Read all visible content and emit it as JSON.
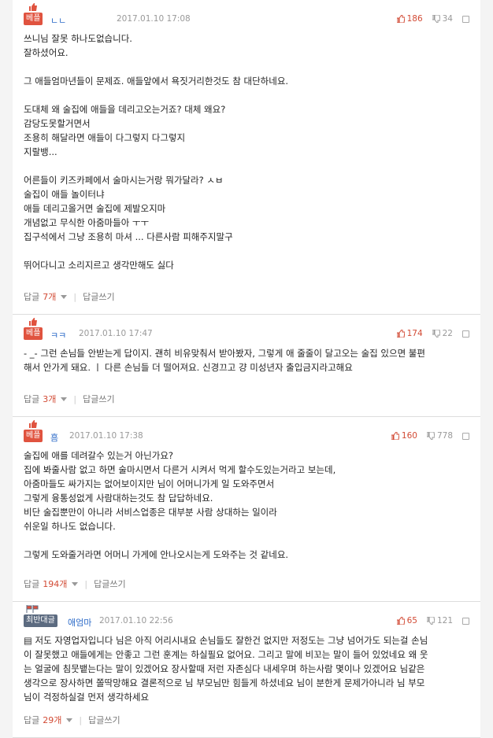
{
  "comments": [
    {
      "badge": "베플",
      "user": "ㄴㄴ",
      "date": "2017.01.10 17:08",
      "up": "186",
      "down": "34",
      "body": "쓰니님 잘못 하나도없습니다.\n잘하셨어요.\n\n그 애들엄마년들이 문제죠. 애들앞에서 욕짓거리한것도 참 대단하네요.\n\n도대체 왜 술집에 애들을 데리고오는거죠? 대체 왜요?\n감당도못할거면서\n조용히 해달라면 애들이 다그렇지 다그렇지\n지랄뱅...\n\n어른들이 키즈카페에서 술마시는거랑 뭐가달라? ㅅㅂ\n술집이 애들 놀이터냐\n애들 데리고올거면 술집에 제발오지마\n개념없고 무식한 아줌마들아 ㅜㅜ\n집구석에서 그냥 조용히 마셔 ... 다른사람 피해주지말구\n\n뛰어다니고 소리지르고 생각만해도 싫다",
      "reply_label": "답글",
      "reply_count": "7개",
      "write_label": "답글쓰기"
    },
    {
      "badge": "베플",
      "user": "ㅋㅋ",
      "date": "2017.01.10 17:47",
      "up": "174",
      "down": "22",
      "body": "- _- 그런 손님들 안받는게 답이지. 괜히 비유맞춰서 받아봤자, 그렇게 애 줄줄이 달고오는 술집 있으면 불편\n해서 안가게 돼요. ㅣ 다른 손님들 더 떨어져요. 신경끄고 걍 미성년자 출입금지라고해요",
      "reply_label": "답글",
      "reply_count": "3개",
      "write_label": "답글쓰기"
    },
    {
      "badge": "베플",
      "user": "흠",
      "date": "2017.01.10 17:38",
      "up": "160",
      "down": "778",
      "body": "술집에 애를 데려갈수 있는거 아닌가요?\n집에 봐줄사람 없고 하면 술마시면서 다른거 시켜서 먹게 할수도있는거라고 보는데,\n아줌마들도 싸가지는 없어보이지만 님이 어머니가게 일 도와주면서\n그렇게 융통성없게 사람대하는것도 참 답답하네요.\n비단 술집뿐만이 아니라 서비스업종은 대부분 사람 상대하는 일이라\n쉬운일 하나도 없습니다.\n\n그렇게 도와줄거라면 어머니 가게에 안나오시는게 도와주는 것 같네요.",
      "reply_label": "답글",
      "reply_count": "194개",
      "write_label": "답글쓰기"
    },
    {
      "badge": "최반대글",
      "user": "애엄마",
      "date": "2017.01.10 22:56",
      "up": "65",
      "down": "121",
      "body": "▤ 저도 자영업자입니다 님은 아직 어리시내요 손님들도 잘한건 없지만 저정도는 그냥 넘어가도 되는걸 손님\n이 잘못했고 애들에게는 안좋고 그런 훈계는 하실필요 없어요. 그리고 말에 비꼬는 말이 들어 있었네요 왜 웃\n는 얼굴에 침뭇뱉는다는 말이 있겠어요 장사할때 저런 자존심다 내세우며 하는사람 몇이나 있겠어요 님같은\n생각으로 장사하면 쫄딱망해요 결론적으로 님 부모님만 힘들게 하셨네요 님이 분한게 문제가아니라 님 부모\n님이 걱정하실걸 먼저 생각하세요",
      "reply_label": "답글",
      "reply_count": "29개",
      "write_label": "답글쓰기"
    }
  ]
}
